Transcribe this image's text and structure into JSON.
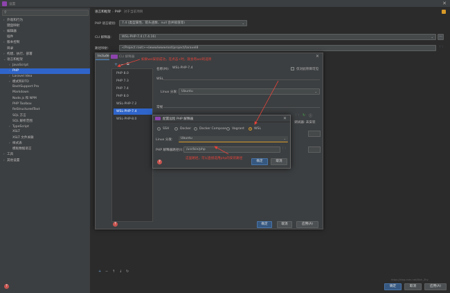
{
  "window": {
    "title": "设置"
  },
  "search": {
    "placeholder": ""
  },
  "sidebar": {
    "items": [
      {
        "label": "外观和行为",
        "arrow": "›",
        "indent": 0
      },
      {
        "label": "键盘映射",
        "arrow": "",
        "indent": 0
      },
      {
        "label": "编辑器",
        "arrow": "›",
        "indent": 0
      },
      {
        "label": "插件",
        "arrow": "",
        "indent": 0
      },
      {
        "label": "版本控制",
        "arrow": "›",
        "indent": 0
      },
      {
        "label": "目录",
        "arrow": "",
        "indent": 0
      },
      {
        "label": "构建、执行、部署",
        "arrow": "›",
        "indent": 0
      },
      {
        "label": "语言和框架",
        "arrow": "⌄",
        "indent": 0
      },
      {
        "label": "JavaScript",
        "arrow": "›",
        "indent": 1
      },
      {
        "label": "PHP",
        "arrow": "›",
        "indent": 1
      },
      {
        "label": "Laravel Idea",
        "arrow": "›",
        "indent": 1
      },
      {
        "label": "模式和DTD",
        "arrow": "›",
        "indent": 1
      },
      {
        "label": "BashSupport Pro",
        "arrow": "",
        "indent": 1
      },
      {
        "label": "Markdown",
        "arrow": "",
        "indent": 1
      },
      {
        "label": "Node.js 和 NPM",
        "arrow": "",
        "indent": 1
      },
      {
        "label": "PHP Toolbox",
        "arrow": "",
        "indent": 1
      },
      {
        "label": "ReStructuredText",
        "arrow": "",
        "indent": 1
      },
      {
        "label": "SQL 方言",
        "arrow": "",
        "indent": 1
      },
      {
        "label": "SQL 解析范围",
        "arrow": "",
        "indent": 1
      },
      {
        "label": "TypeScript",
        "arrow": "›",
        "indent": 1
      },
      {
        "label": "XSLT",
        "arrow": "",
        "indent": 1
      },
      {
        "label": "XSLT 文件关联",
        "arrow": "",
        "indent": 1
      },
      {
        "label": "样式表",
        "arrow": "›",
        "indent": 1
      },
      {
        "label": "模板数据语言",
        "arrow": "",
        "indent": 1
      },
      {
        "label": "工具",
        "arrow": "›",
        "indent": 0
      },
      {
        "label": "其他设置",
        "arrow": "›",
        "indent": 0
      }
    ]
  },
  "header": {
    "crumb1": "语言和框架",
    "crumb2": "PHP",
    "project": "对于当前项目"
  },
  "php": {
    "level_label": "PHP 语言级别:",
    "level_value": "7.4 (类型属性、箭头函数、null 合并赋值等)",
    "cli_label": "CLI 解释器:",
    "cli_value": "WSL-PHP-7.4 (7.4.16)",
    "path_label": "路径映射:",
    "path_value": "<Project root>→/www/wwwroot/project/laravel8"
  },
  "include": {
    "tab": "Include",
    "cli_title": "CLI 解释器"
  },
  "interpreters": [
    "PHP 8.0",
    "PHP 7.3",
    "PHP 7.4",
    "PHP 8.0",
    "WSL-PHP-7.2",
    "WSL-PHP-7.4",
    "WSL-PHP-8.0"
  ],
  "detail": {
    "name_label": "名称(M):",
    "name_value": "WSL-PHP-7.4",
    "visible_label": "仅对此项目可见",
    "wsl_section": "WSL",
    "linux_label": "Linux 分发:",
    "linux_value": "Ubuntu",
    "general_section": "常规",
    "debugger_label": "调试器: 未安装"
  },
  "remote": {
    "title": "配置远程 PHP 解释器",
    "options": [
      "SSH",
      "Docker",
      "Docker Compose",
      "Vagrant",
      "WSL"
    ],
    "linux_label": "Linux 分发:",
    "linux_value": "Ubuntu",
    "exe_label": "PHP 解释器路径(I):",
    "exe_value": "/usr/bin/php",
    "ok": "确定",
    "cancel": "取消"
  },
  "dialog_buttons": {
    "ok": "确定",
    "cancel": "取消",
    "apply": "应用(A)"
  },
  "main_buttons": {
    "ok": "确定",
    "cancel": "取消",
    "apply": "应用(A)"
  },
  "annotations": {
    "top": "如果wsl安装成功，在点击+时，就会有wsl的选项",
    "bottom": "这里路径，可以直接选用php的安装路径"
  },
  "watermark": "https://blog.csdn.net/Wxh_Zhy",
  "colors": {
    "accent": "#2f65ca",
    "annotation": "#e8433a",
    "wsl_highlight": "#d99a28"
  }
}
